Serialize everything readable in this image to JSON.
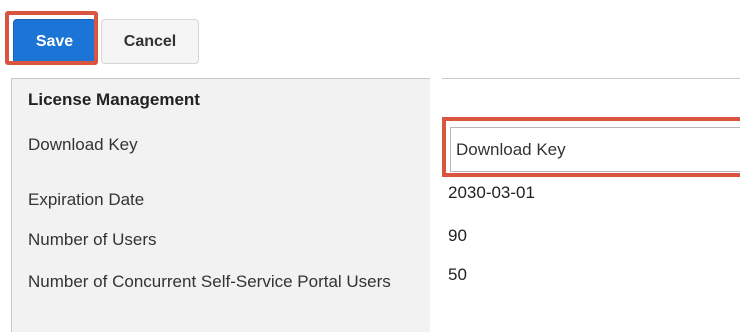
{
  "toolbar": {
    "save_label": "Save",
    "cancel_label": "Cancel"
  },
  "panel": {
    "title": "License Management",
    "fields": [
      {
        "label": "Download Key",
        "value": "Download Key"
      },
      {
        "label": "Expiration Date",
        "value": "2030-03-01"
      },
      {
        "label": "Number of Users",
        "value": "90"
      },
      {
        "label": "Number of Concurrent Self-Service Portal Users",
        "value": "50"
      }
    ]
  },
  "colors": {
    "primary_button": "#1b74d6",
    "highlight": "#d9553f",
    "panel_background": "#f2f2f2"
  }
}
